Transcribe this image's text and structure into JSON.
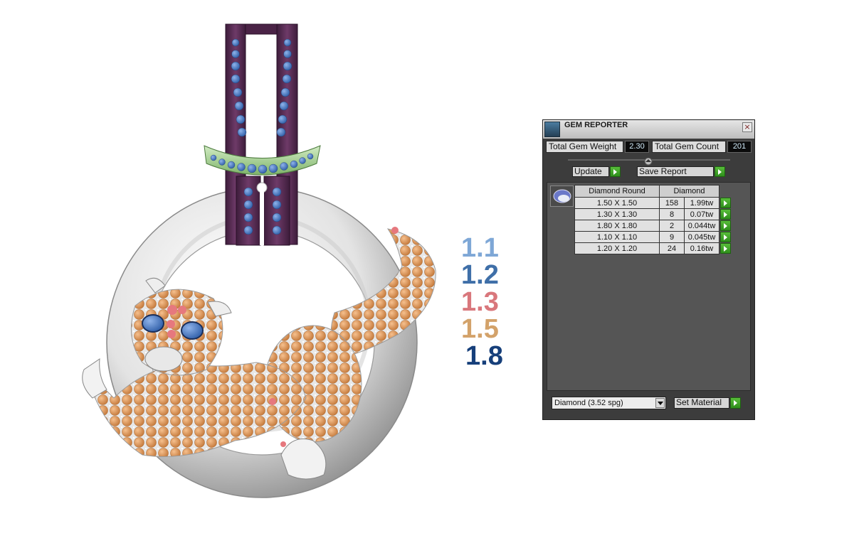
{
  "legend": {
    "items": [
      {
        "label": "1.1",
        "color": "#7ea7d6"
      },
      {
        "label": "1.2",
        "color": "#3f6fa8"
      },
      {
        "label": "1.3",
        "color": "#d9777c"
      },
      {
        "label": "1.5",
        "color": "#d3a26a"
      },
      {
        "label": "1.8",
        "color": "#163f7a"
      }
    ]
  },
  "panel": {
    "title": "GEM REPORTER",
    "close_glyph": "×",
    "total_weight_label": "Total Gem Weight",
    "total_weight_value": "2.30",
    "total_count_label": "Total Gem Count",
    "total_count_value": "201",
    "update_label": "Update",
    "save_report_label": "Save Report",
    "table": {
      "headers": [
        "Diamond Round",
        "Diamond"
      ],
      "rows": [
        {
          "size": "1.50 X 1.50",
          "count": "158",
          "weight": "1.99tw"
        },
        {
          "size": "1.30 X 1.30",
          "count": "8",
          "weight": "0.07tw"
        },
        {
          "size": "1.80 X 1.80",
          "count": "2",
          "weight": "0.044tw"
        },
        {
          "size": "1.10 X 1.10",
          "count": "9",
          "weight": "0.045tw"
        },
        {
          "size": "1.20 X 1.20",
          "count": "24",
          "weight": "0.16tw"
        }
      ]
    },
    "material_select": "Diamond     (3.52 spg)",
    "set_material_label": "Set Material"
  },
  "colors": {
    "gem_orange": "#e39a5c",
    "gem_blue": "#5a86d2",
    "gem_pink": "#e6787e",
    "bail_purple": "#5a2e55",
    "band_green": "#a8d497",
    "metal_silver": "#d7d7d7"
  }
}
